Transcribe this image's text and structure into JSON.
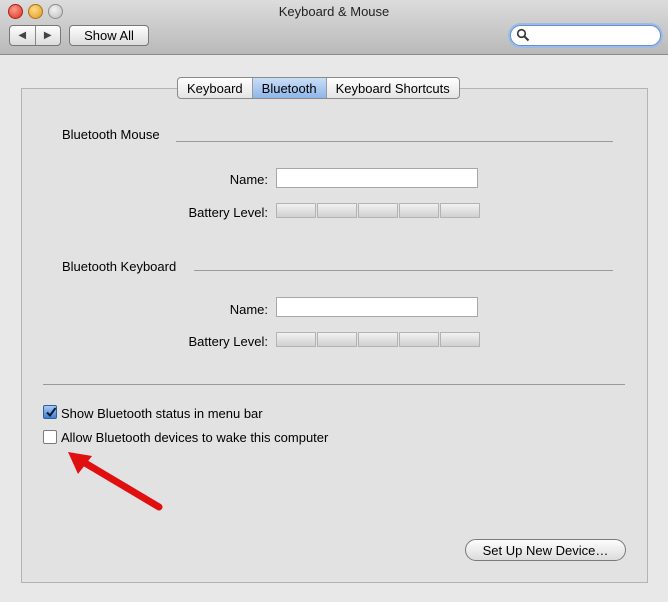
{
  "window": {
    "title": "Keyboard & Mouse"
  },
  "toolbar": {
    "show_all_label": "Show All",
    "search_value": ""
  },
  "tabs": [
    {
      "label": "Keyboard",
      "active": false
    },
    {
      "label": "Bluetooth",
      "active": true
    },
    {
      "label": "Keyboard Shortcuts",
      "active": false
    }
  ],
  "mouse": {
    "title": "Bluetooth Mouse",
    "name_label": "Name:",
    "name_value": "",
    "battery_label": "Battery Level:"
  },
  "keyboard": {
    "title": "Bluetooth Keyboard",
    "name_label": "Name:",
    "name_value": "",
    "battery_label": "Battery Level:"
  },
  "options": {
    "show_status_label": "Show Bluetooth status in menu bar",
    "show_status_checked": true,
    "allow_wake_label": "Allow Bluetooth devices to wake this computer",
    "allow_wake_checked": false
  },
  "setup_button_label": "Set Up New Device…",
  "colors": {
    "active_tab": "#8fb6e8",
    "annotation_arrow": "#e01010"
  }
}
